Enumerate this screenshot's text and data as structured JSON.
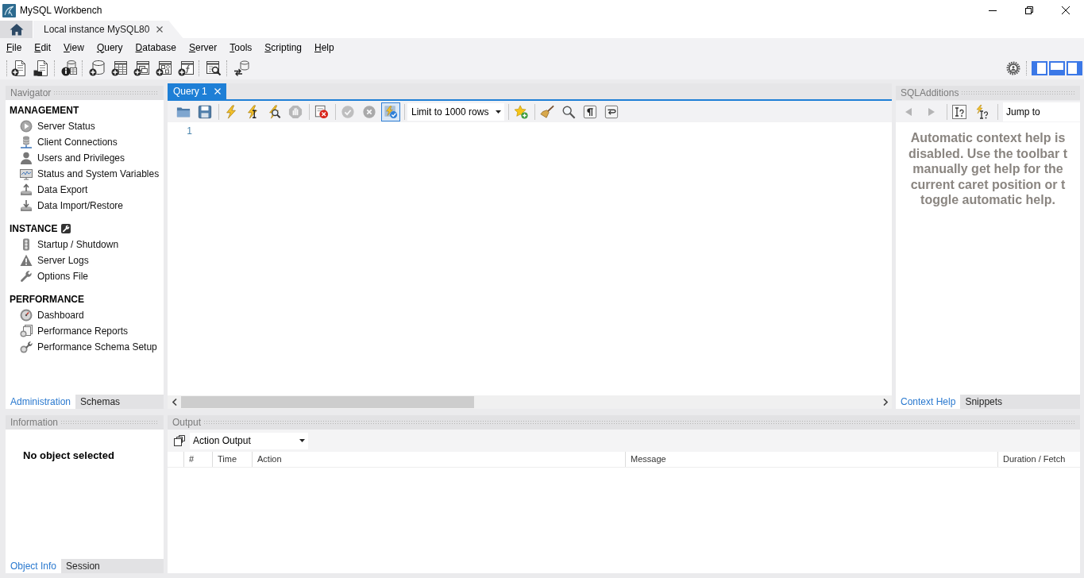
{
  "window": {
    "title": "MySQL Workbench"
  },
  "doc_tabs": [
    {
      "kind": "home",
      "selected": false
    },
    {
      "kind": "connection",
      "label": "Local instance MySQL80",
      "selected": true
    }
  ],
  "menu": [
    "File",
    "Edit",
    "View",
    "Query",
    "Database",
    "Server",
    "Tools",
    "Scripting",
    "Help"
  ],
  "panel_toggles": [
    {
      "kind": "left",
      "on": true
    },
    {
      "kind": "bottom",
      "on": true
    },
    {
      "kind": "right",
      "on": true
    }
  ],
  "navigator": {
    "title": "Navigator",
    "sections": [
      {
        "title": "MANAGEMENT",
        "items": [
          "Server Status",
          "Client Connections",
          "Users and Privileges",
          "Status and System Variables",
          "Data Export",
          "Data Import/Restore"
        ]
      },
      {
        "title": "INSTANCE",
        "items": [
          "Startup / Shutdown",
          "Server Logs",
          "Options File"
        ]
      },
      {
        "title": "PERFORMANCE",
        "items": [
          "Dashboard",
          "Performance Reports",
          "Performance Schema Setup"
        ]
      }
    ],
    "tabs": [
      {
        "label": "Administration",
        "selected": true
      },
      {
        "label": "Schemas",
        "selected": false
      }
    ]
  },
  "query_tabs": [
    {
      "label": "Query 1",
      "selected": true
    }
  ],
  "query_toolbar": {
    "buttons": [
      {
        "disabled": false,
        "pressed": false
      },
      {
        "disabled": false,
        "pressed": false
      },
      {
        "disabled": false,
        "pressed": false
      },
      {
        "disabled": false,
        "pressed": false
      },
      {
        "disabled": false,
        "pressed": false
      },
      {
        "disabled": true,
        "pressed": false
      },
      {
        "disabled": false,
        "pressed": false
      },
      {
        "disabled": true,
        "pressed": false
      },
      {
        "disabled": true,
        "pressed": false
      },
      {
        "disabled": false,
        "pressed": true
      },
      {
        "disabled": false,
        "pressed": false
      },
      {
        "disabled": false,
        "pressed": false
      },
      {
        "disabled": false,
        "pressed": false
      },
      {
        "disabled": false,
        "pressed": false
      },
      {
        "disabled": false,
        "pressed": false
      }
    ],
    "row_limit": "Limit to 1000 rows"
  },
  "editor": {
    "line_numbers": [
      "1"
    ]
  },
  "sql_additions": {
    "title": "SQLAdditions",
    "buttons": [
      {
        "disabled": true
      },
      {
        "disabled": true
      },
      {
        "disabled": false
      },
      {
        "disabled": false
      }
    ],
    "jump_to": "Jump to",
    "help_text": [
      "Automatic context help is",
      "disabled. Use the toolbar t",
      "manually get help for the",
      "current caret position or t",
      "toggle automatic help."
    ],
    "tabs": [
      {
        "label": "Context Help",
        "selected": true
      },
      {
        "label": "Snippets",
        "selected": false
      }
    ]
  },
  "information": {
    "title": "Information",
    "message": "No object selected",
    "tabs": [
      {
        "label": "Object Info",
        "selected": true
      },
      {
        "label": "Session",
        "selected": false
      }
    ]
  },
  "output": {
    "title": "Output",
    "view": "Action Output",
    "columns": [
      "#",
      "Time",
      "Action",
      "Message",
      "Duration / Fetch"
    ]
  }
}
